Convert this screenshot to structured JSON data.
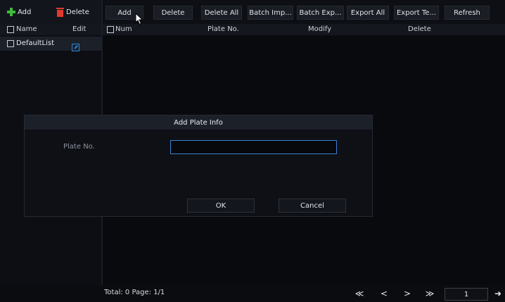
{
  "left_panel": {
    "toolbar": {
      "add_label": "Add",
      "delete_label": "Delete"
    },
    "columns": {
      "name": "Name",
      "edit": "Edit"
    },
    "rows": [
      {
        "name": "DefaultList"
      }
    ]
  },
  "right_panel": {
    "toolbar": {
      "buttons": [
        "Add",
        "Delete",
        "Delete All",
        "Batch Imp...",
        "Batch Exp...",
        "Export All",
        "Export Te...",
        "Refresh"
      ]
    },
    "columns": {
      "num": "Num",
      "plate_no": "Plate No.",
      "modify": "Modify",
      "delete": "Delete"
    }
  },
  "footer": {
    "total_text": "Total: 0  Page: 1/1",
    "first": "≪",
    "prev": "<",
    "next": ">",
    "last": "≫",
    "page_value": "1",
    "go": "➜"
  },
  "dialog": {
    "title": "Add Plate Info",
    "plate_label": "Plate No.",
    "plate_value": "",
    "ok_label": "OK",
    "cancel_label": "Cancel"
  },
  "colors": {
    "accent_blue": "#3c7fd6",
    "add_green": "#3dbb3a",
    "delete_red": "#e03a2f"
  },
  "icons": [
    "plus-icon",
    "trash-icon",
    "edit-icon",
    "cursor-icon",
    "go-arrow-icon"
  ]
}
